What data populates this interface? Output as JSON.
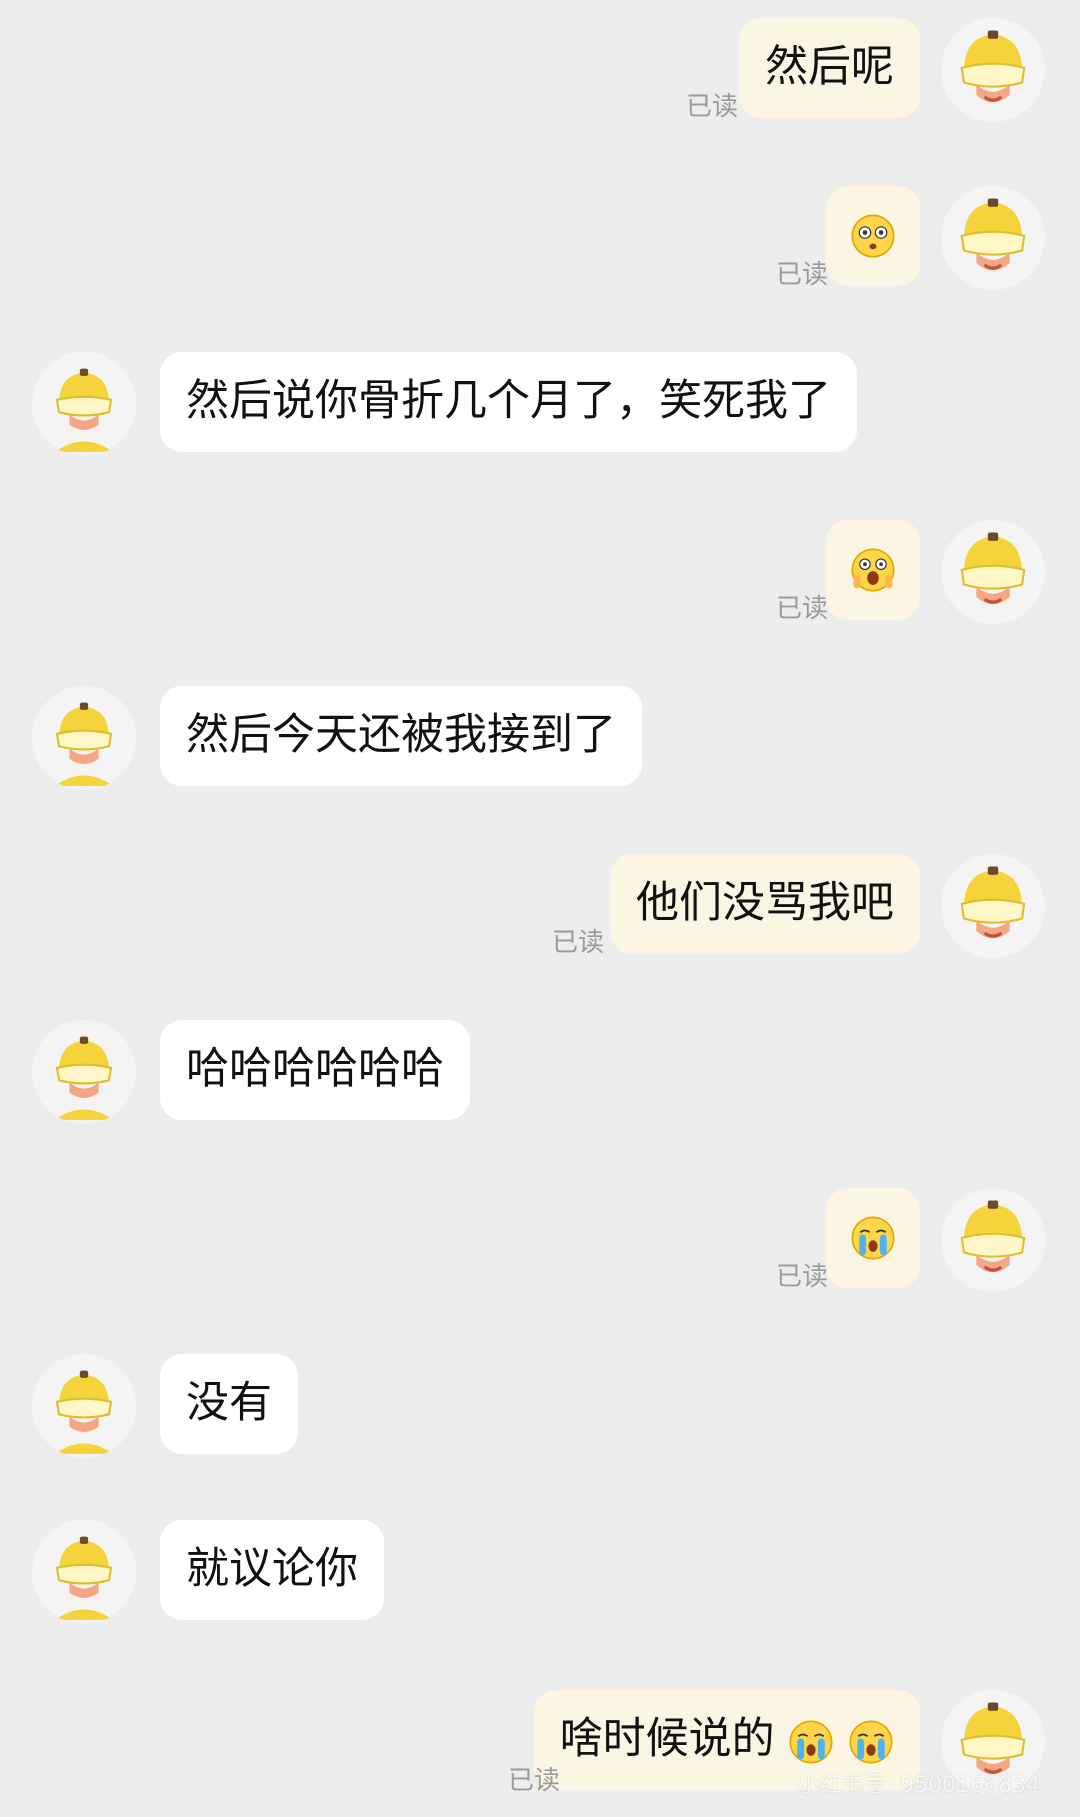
{
  "read_label": "已读",
  "messages": [
    {
      "side": "me",
      "type": "text",
      "text": "然后呢",
      "read": "已读"
    },
    {
      "side": "me",
      "type": "emoji",
      "emoji": "shocked-face"
    },
    {
      "side": "them",
      "type": "text",
      "text": "然后说你骨折几个月了，笑死我了"
    },
    {
      "side": "me",
      "type": "emoji",
      "emoji": "screaming-face"
    },
    {
      "side": "them",
      "type": "text",
      "text": "然后今天还被我接到了"
    },
    {
      "side": "me",
      "type": "text",
      "text": "他们没骂我吧",
      "read": "已读"
    },
    {
      "side": "them",
      "type": "text",
      "text": "哈哈哈哈哈哈"
    },
    {
      "side": "me",
      "type": "emoji",
      "emoji": "crying-face"
    },
    {
      "side": "them",
      "type": "text",
      "text": "没有"
    },
    {
      "side": "them",
      "type": "text",
      "text": "就议论你"
    },
    {
      "side": "me",
      "type": "text",
      "text": "啥时候说的",
      "read": "已读",
      "trailing_emoji": "crying-face"
    }
  ],
  "watermark": "小红书号: 9500166834",
  "colors": {
    "background": "#ededed",
    "my_bubble": "#fbf6e3",
    "their_bubble": "#ffffff",
    "helmet": "#f5d33a"
  }
}
